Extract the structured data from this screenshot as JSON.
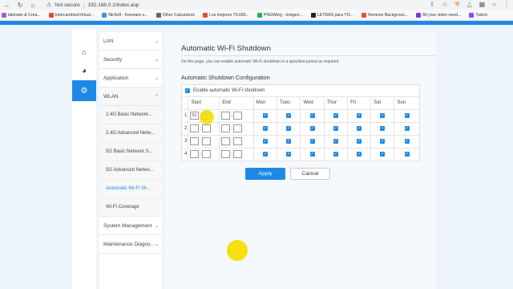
{
  "browser": {
    "security_label": "Not secure",
    "url": "192.168.0.1/index.asp",
    "bookmarks": [
      {
        "label": "labórate & Crea...",
        "color": "#9c5fd1"
      },
      {
        "label": "IntercambiosVirtual...",
        "color": "#e24b3b"
      },
      {
        "label": "NirSoft - freeware u...",
        "color": "#4a8fdc"
      },
      {
        "label": "Other Calculators",
        "color": "#666666"
      },
      {
        "label": "Los mejores 70.000...",
        "color": "#e24b3b"
      },
      {
        "label": "PNGWing - imágen...",
        "color": "#33a853"
      },
      {
        "label": "LETRAS para YO...",
        "color": "#222222"
      },
      {
        "label": "Remove Backgroun...",
        "color": "#e24b3b"
      },
      {
        "label": "All your video need...",
        "color": "#7a3fc9"
      },
      {
        "label": "Twitch",
        "color": "#9146ff"
      }
    ]
  },
  "sidebar": {
    "top_items": [
      {
        "label": "LAN"
      },
      {
        "label": "Security"
      },
      {
        "label": "Application"
      },
      {
        "label": "WLAN"
      }
    ],
    "wlan_sub": [
      {
        "label": "2.4G Basic Network..."
      },
      {
        "label": "2.4G Advanced Netw..."
      },
      {
        "label": "5G Basic Network S..."
      },
      {
        "label": "5G Advanced Netwo..."
      },
      {
        "label": "Automatic Wi-Fi Sh..."
      },
      {
        "label": "Wi-Fi Coverage"
      }
    ],
    "bottom_items": [
      {
        "label": "System Management"
      },
      {
        "label": "Maintenance Diagno..."
      }
    ]
  },
  "main": {
    "title": "Automatic Wi-Fi Shutdown",
    "description": "On this page, you can enable automatic Wi-Fi shutdown in a specified period as required.",
    "section_title": "Automatic Shutdown Configuration",
    "enable_label": "Enable automatic Wi-Fi shutdown",
    "enable_checked": true,
    "columns": [
      "Start",
      "End",
      "Mon",
      "Tues",
      "Wed",
      "Thur",
      "Fri",
      "Sat",
      "Sun"
    ],
    "rows": [
      {
        "index": "1",
        "start_h": "01",
        "start_m": "00",
        "end_h": "",
        "end_m": ""
      },
      {
        "index": "2",
        "start_h": "",
        "start_m": "",
        "end_h": "",
        "end_m": ""
      },
      {
        "index": "3",
        "start_h": "",
        "start_m": "",
        "end_h": "",
        "end_m": ""
      },
      {
        "index": "4",
        "start_h": "",
        "start_m": "",
        "end_h": "",
        "end_m": ""
      }
    ],
    "apply_label": "Apply",
    "cancel_label": "Cancel"
  },
  "colors": {
    "accent": "#1e88e5",
    "highlight": "#f5de00"
  }
}
